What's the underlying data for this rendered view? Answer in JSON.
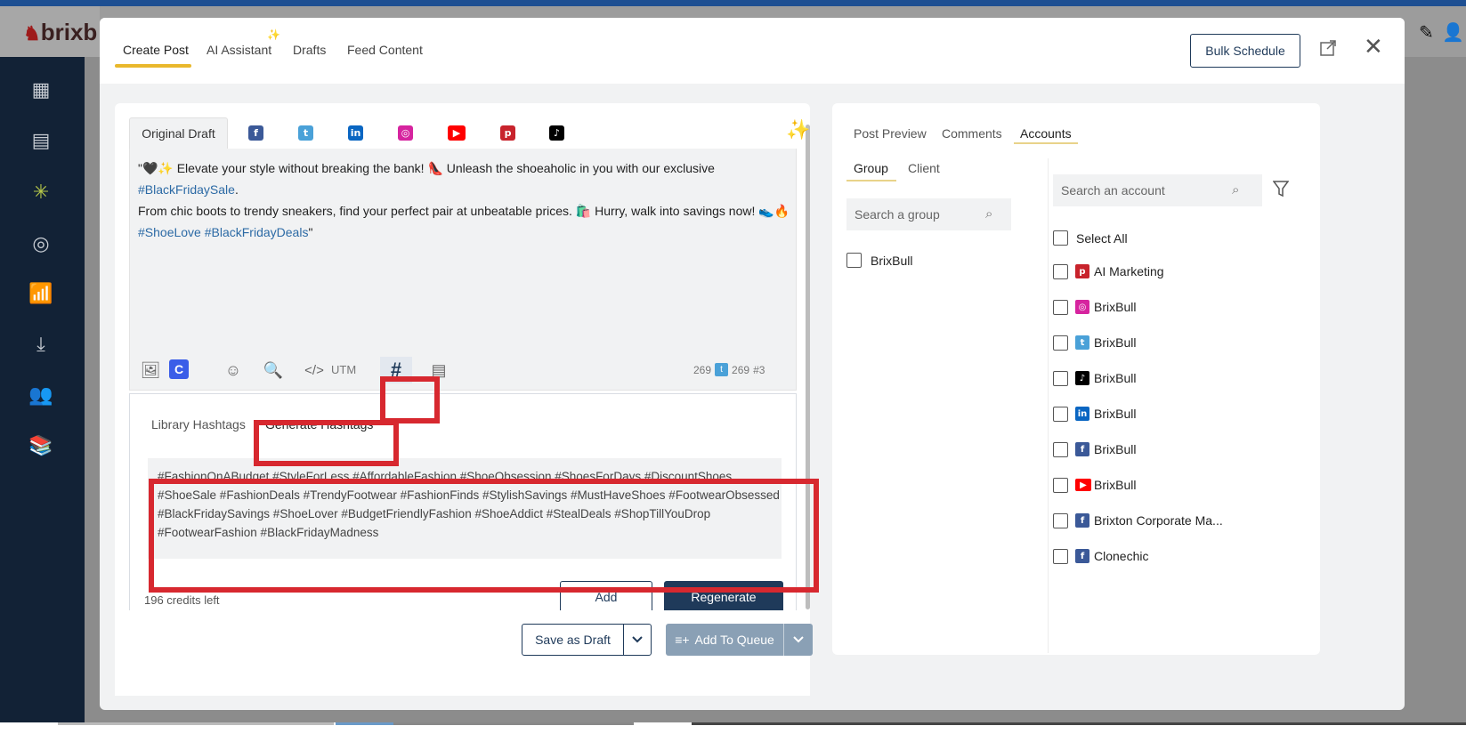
{
  "brand": {
    "name": "brixb"
  },
  "modal": {
    "tabs": [
      {
        "label": "Create Post"
      },
      {
        "label": "AI Assistant"
      },
      {
        "label": "Drafts"
      },
      {
        "label": "Feed Content"
      }
    ],
    "bulk_schedule_label": "Bulk Schedule"
  },
  "editor": {
    "draft_tab_label": "Original Draft",
    "networks": [
      "facebook",
      "twitter",
      "linkedin",
      "instagram",
      "youtube",
      "pinterest",
      "tiktok"
    ],
    "post_line1": "\"🖤✨ Elevate your style without breaking the bank! 👠 Unleash the shoeaholic in you with our exclusive ",
    "post_tag1": "#BlackFridaySale",
    "post_line1_end": ".",
    "post_line2": "From chic boots to trendy sneakers, find your perfect pair at unbeatable prices. 🛍️ Hurry, walk into savings now! 👟🔥",
    "post_tags_line3": "#ShoeLove #BlackFridayDeals",
    "post_line3_end": "\"",
    "toolbar": {
      "utm_label": "UTM",
      "char_count": "269",
      "twitter_count": "269",
      "hashtag_count": "#3"
    }
  },
  "hashtags": {
    "tab_library": "Library Hashtags",
    "tab_generate": "Generate Hashtags",
    "generated_text": "#FashionOnABudget #StyleForLess #AffordableFashion #ShoeObsession #ShoesForDays #DiscountShoes #ShoeSale #FashionDeals #TrendyFootwear #FashionFinds #StylishSavings #MustHaveShoes #FootwearObsessed #BlackFridaySavings #ShoeLover #BudgetFriendlyFashion #ShoeAddict #StealDeals #ShopTillYouDrop #FootwearFashion #BlackFridayMadness",
    "credits_text": "196 credits left",
    "add_label": "Add",
    "regenerate_label": "Regenerate"
  },
  "footer": {
    "save_draft_label": "Save as Draft",
    "add_queue_label": "Add To Queue"
  },
  "right": {
    "tabs": [
      {
        "label": "Post Preview"
      },
      {
        "label": "Comments"
      },
      {
        "label": "Accounts"
      }
    ],
    "subtabs": [
      {
        "label": "Group"
      },
      {
        "label": "Client"
      }
    ],
    "group_search_placeholder": "Search a group",
    "account_search_placeholder": "Search an account",
    "groups": [
      {
        "label": "BrixBull"
      }
    ],
    "select_all_label": "Select All",
    "accounts": [
      {
        "network": "pinterest",
        "label": "AI Marketing"
      },
      {
        "network": "instagram",
        "label": "BrixBull"
      },
      {
        "network": "twitter",
        "label": "BrixBull"
      },
      {
        "network": "tiktok",
        "label": "BrixBull"
      },
      {
        "network": "linkedin",
        "label": "BrixBull"
      },
      {
        "network": "facebook",
        "label": "BrixBull"
      },
      {
        "network": "youtube",
        "label": "BrixBull"
      },
      {
        "network": "facebook",
        "label": "Brixton Corporate Ma..."
      },
      {
        "network": "facebook",
        "label": "Clonechic"
      }
    ]
  },
  "colors": {
    "navy": "#1f3a5a",
    "highlight_red": "#d7282f",
    "accent_yellow": "#e9b82c",
    "sidebar": "#122236"
  }
}
